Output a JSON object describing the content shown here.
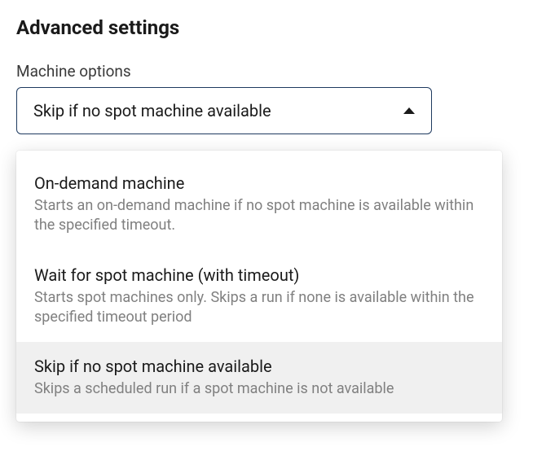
{
  "heading": "Advanced settings",
  "field_label": "Machine options",
  "selected_value": "Skip if no spot machine available",
  "options": [
    {
      "title": "On-demand machine",
      "desc": "Starts an on-demand machine if no spot machine is available within the specified timeout.",
      "selected": false
    },
    {
      "title": "Wait for spot machine (with timeout)",
      "desc": "Starts spot machines only. Skips a run if none is available within the specified timeout period",
      "selected": false
    },
    {
      "title": "Skip if no spot machine available",
      "desc": "Skips a scheduled run if a spot machine is not available",
      "selected": true
    }
  ]
}
